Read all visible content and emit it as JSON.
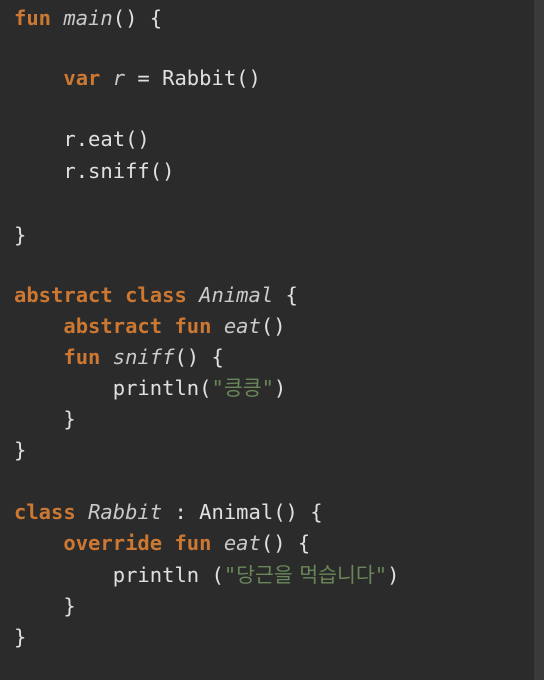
{
  "editor": {
    "colors": {
      "background": "#2b2b2b",
      "keyword": "#cc7832",
      "text": "#e0e0e0",
      "string": "#6a8759"
    },
    "lines": [
      {
        "tokens": [
          {
            "text": "fun",
            "kind": "keyword"
          },
          {
            "text": " ",
            "kind": "plain"
          },
          {
            "text": "main",
            "kind": "function"
          },
          {
            "text": "() {",
            "kind": "plain"
          }
        ]
      },
      {
        "tokens": [
          {
            "text": "    ",
            "kind": "plain"
          },
          {
            "text": "var",
            "kind": "keyword"
          },
          {
            "text": " ",
            "kind": "plain"
          },
          {
            "text": "r",
            "kind": "function"
          },
          {
            "text": " = Rabbit()",
            "kind": "plain"
          }
        ]
      },
      {
        "tokens": [
          {
            "text": "    r.eat()",
            "kind": "plain"
          }
        ]
      },
      {
        "tokens": [
          {
            "text": "    r.sniff()",
            "kind": "plain"
          }
        ]
      },
      {
        "tokens": [
          {
            "text": "}",
            "kind": "plain"
          }
        ]
      },
      {
        "tokens": [
          {
            "text": "abstract",
            "kind": "keyword"
          },
          {
            "text": " ",
            "kind": "plain"
          },
          {
            "text": "class",
            "kind": "keyword"
          },
          {
            "text": " ",
            "kind": "plain"
          },
          {
            "text": "Animal",
            "kind": "function"
          },
          {
            "text": " {",
            "kind": "plain"
          }
        ]
      },
      {
        "tokens": [
          {
            "text": "    ",
            "kind": "plain"
          },
          {
            "text": "abstract",
            "kind": "keyword"
          },
          {
            "text": " ",
            "kind": "plain"
          },
          {
            "text": "fun",
            "kind": "keyword"
          },
          {
            "text": " ",
            "kind": "plain"
          },
          {
            "text": "eat",
            "kind": "function"
          },
          {
            "text": "()",
            "kind": "plain"
          }
        ]
      },
      {
        "tokens": [
          {
            "text": "    ",
            "kind": "plain"
          },
          {
            "text": "fun",
            "kind": "keyword"
          },
          {
            "text": " ",
            "kind": "plain"
          },
          {
            "text": "sniff",
            "kind": "function"
          },
          {
            "text": "() {",
            "kind": "plain"
          }
        ]
      },
      {
        "tokens": [
          {
            "text": "        println(",
            "kind": "plain"
          },
          {
            "text": "\"",
            "kind": "string"
          },
          {
            "text": "킁킁",
            "kind": "string-korean"
          },
          {
            "text": "\"",
            "kind": "string"
          },
          {
            "text": ")",
            "kind": "plain"
          }
        ]
      },
      {
        "tokens": [
          {
            "text": "    }",
            "kind": "plain"
          }
        ]
      },
      {
        "tokens": [
          {
            "text": "}",
            "kind": "plain"
          }
        ]
      },
      {
        "tokens": [
          {
            "text": "class",
            "kind": "keyword"
          },
          {
            "text": " ",
            "kind": "plain"
          },
          {
            "text": "Rabbit",
            "kind": "function"
          },
          {
            "text": " : Animal() {",
            "kind": "plain"
          }
        ]
      },
      {
        "tokens": [
          {
            "text": "    ",
            "kind": "plain"
          },
          {
            "text": "override",
            "kind": "keyword"
          },
          {
            "text": " ",
            "kind": "plain"
          },
          {
            "text": "fun",
            "kind": "keyword"
          },
          {
            "text": " ",
            "kind": "plain"
          },
          {
            "text": "eat",
            "kind": "function"
          },
          {
            "text": "() {",
            "kind": "plain"
          }
        ]
      },
      {
        "tokens": [
          {
            "text": "        println (",
            "kind": "plain"
          },
          {
            "text": "\"",
            "kind": "string"
          },
          {
            "text": "당근을 먹습니다",
            "kind": "string-korean"
          },
          {
            "text": "\"",
            "kind": "string"
          },
          {
            "text": ")",
            "kind": "plain"
          }
        ]
      },
      {
        "tokens": [
          {
            "text": "    }",
            "kind": "plain"
          }
        ]
      },
      {
        "tokens": [
          {
            "text": "}",
            "kind": "plain"
          }
        ]
      }
    ]
  }
}
